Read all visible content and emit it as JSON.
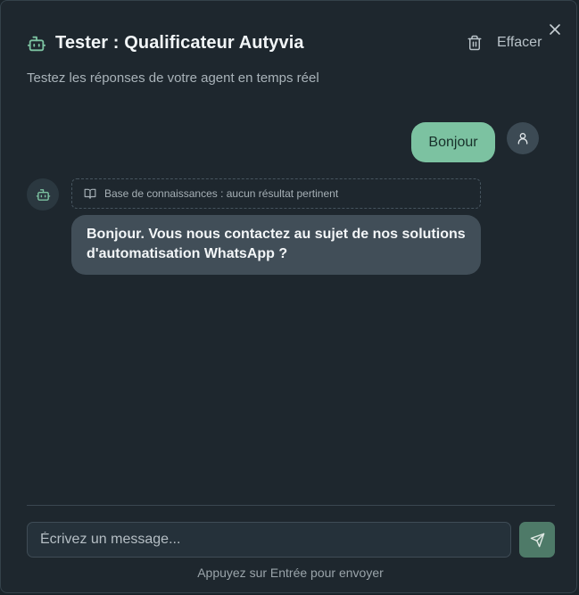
{
  "header": {
    "title": "Tester : Qualificateur Autyvia",
    "subtitle": "Testez les réponses de votre agent en temps réel",
    "clear_label": "Effacer"
  },
  "messages": [
    {
      "role": "user",
      "text": "Bonjour"
    },
    {
      "role": "bot",
      "knowledge_note": "Base de connaissances : aucun résultat pertinent",
      "text": "Bonjour. Vous nous contactez au sujet de nos solutions d'automatisation WhatsApp ?"
    }
  ],
  "composer": {
    "placeholder": "Écrivez un message...",
    "value": "",
    "hint": "Appuyez sur Entrée pour envoyer"
  },
  "icons": {
    "close": "close-icon",
    "bot": "bot-icon",
    "trash": "trash-icon",
    "user": "user-icon",
    "book": "book-open-icon",
    "send": "send-icon"
  },
  "colors": {
    "accent": "#7cc2a1",
    "send_button": "#4e7a68",
    "bot_bubble": "#414e58",
    "background": "#1e272e"
  }
}
